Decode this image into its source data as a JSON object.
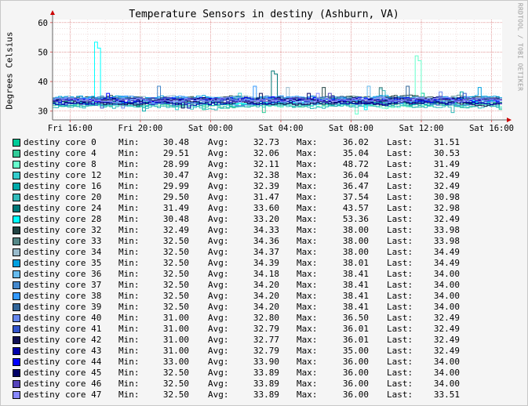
{
  "title": "Temperature Sensors in destiny (Ashburn, VA)",
  "watermark": "RRDTOOL / TOBI OETIKER",
  "stat_labels": {
    "min": "Min:",
    "avg": "Avg:",
    "max": "Max:",
    "last": "Last:"
  },
  "chart_data": {
    "type": "line",
    "title": "Temperature Sensors in destiny (Ashburn, VA)",
    "ylabel": "Degrees Celsius",
    "xlabel": "",
    "ylim": [
      27,
      61
    ],
    "yticks": [
      30,
      40,
      50,
      60
    ],
    "xlim_hours": [
      15,
      40.6
    ],
    "xticks": [
      {
        "label": "Fri 16:00",
        "hour": 16
      },
      {
        "label": "Fri 20:00",
        "hour": 20
      },
      {
        "label": "Sat 00:00",
        "hour": 24
      },
      {
        "label": "Sat 04:00",
        "hour": 28
      },
      {
        "label": "Sat 08:00",
        "hour": 32
      },
      {
        "label": "Sat 12:00",
        "hour": 36
      },
      {
        "label": "Sat 16:00",
        "hour": 40
      }
    ],
    "grid": true,
    "legend_placement": "bottom",
    "series": [
      {
        "name": "destiny core 0",
        "color": "#00cc99",
        "min": "30.48",
        "avg": "32.73",
        "max": "36.02",
        "last": "31.51"
      },
      {
        "name": "destiny core 4",
        "color": "#33cc99",
        "min": "29.51",
        "avg": "32.06",
        "max": "35.04",
        "last": "30.53"
      },
      {
        "name": "destiny core 8",
        "color": "#66ffcc",
        "min": "28.99",
        "avg": "32.11",
        "max": "48.72",
        "last": "31.49"
      },
      {
        "name": "destiny core 12",
        "color": "#33cccc",
        "min": "30.47",
        "avg": "32.38",
        "max": "36.04",
        "last": "32.49"
      },
      {
        "name": "destiny core 16",
        "color": "#00aaaa",
        "min": "29.99",
        "avg": "32.39",
        "max": "36.47",
        "last": "32.49"
      },
      {
        "name": "destiny core 20",
        "color": "#33bbbb",
        "min": "29.50",
        "avg": "31.47",
        "max": "37.54",
        "last": "30.98"
      },
      {
        "name": "destiny core 24",
        "color": "#007777",
        "min": "31.49",
        "avg": "33.60",
        "max": "43.57",
        "last": "32.98"
      },
      {
        "name": "destiny core 28",
        "color": "#00ffff",
        "min": "30.48",
        "avg": "33.20",
        "max": "53.36",
        "last": "32.49"
      },
      {
        "name": "destiny core 32",
        "color": "#224444",
        "min": "32.49",
        "avg": "34.33",
        "max": "38.00",
        "last": "33.98"
      },
      {
        "name": "destiny core 33",
        "color": "#558888",
        "min": "32.50",
        "avg": "34.36",
        "max": "38.00",
        "last": "33.98"
      },
      {
        "name": "destiny core 34",
        "color": "#99bbcc",
        "min": "32.50",
        "avg": "34.37",
        "max": "38.00",
        "last": "34.49"
      },
      {
        "name": "destiny core 35",
        "color": "#00a0e0",
        "min": "32.50",
        "avg": "34.39",
        "max": "38.01",
        "last": "34.49"
      },
      {
        "name": "destiny core 36",
        "color": "#66bbee",
        "min": "32.50",
        "avg": "34.18",
        "max": "38.41",
        "last": "34.00"
      },
      {
        "name": "destiny core 37",
        "color": "#4488cc",
        "min": "32.50",
        "avg": "34.20",
        "max": "38.41",
        "last": "34.00"
      },
      {
        "name": "destiny core 38",
        "color": "#3399ff",
        "min": "32.50",
        "avg": "34.20",
        "max": "38.41",
        "last": "34.00"
      },
      {
        "name": "destiny core 39",
        "color": "#336699",
        "min": "32.50",
        "avg": "34.20",
        "max": "38.41",
        "last": "34.00"
      },
      {
        "name": "destiny core 40",
        "color": "#6688ee",
        "min": "31.00",
        "avg": "32.80",
        "max": "36.50",
        "last": "32.49"
      },
      {
        "name": "destiny core 41",
        "color": "#3355cc",
        "min": "31.00",
        "avg": "32.79",
        "max": "36.01",
        "last": "32.49"
      },
      {
        "name": "destiny core 42",
        "color": "#111155",
        "min": "31.00",
        "avg": "32.77",
        "max": "36.01",
        "last": "32.49"
      },
      {
        "name": "destiny core 43",
        "color": "#0000aa",
        "min": "31.00",
        "avg": "32.79",
        "max": "35.00",
        "last": "32.49"
      },
      {
        "name": "destiny core 44",
        "color": "#0000ff",
        "min": "33.00",
        "avg": "33.90",
        "max": "36.00",
        "last": "34.00"
      },
      {
        "name": "destiny core 45",
        "color": "#000066",
        "min": "32.50",
        "avg": "33.89",
        "max": "36.00",
        "last": "34.00"
      },
      {
        "name": "destiny core 46",
        "color": "#5544bb",
        "min": "32.50",
        "avg": "33.89",
        "max": "36.00",
        "last": "34.00"
      },
      {
        "name": "destiny core 47",
        "color": "#8888ff",
        "min": "32.50",
        "avg": "33.89",
        "max": "36.00",
        "last": "33.51"
      }
    ]
  }
}
